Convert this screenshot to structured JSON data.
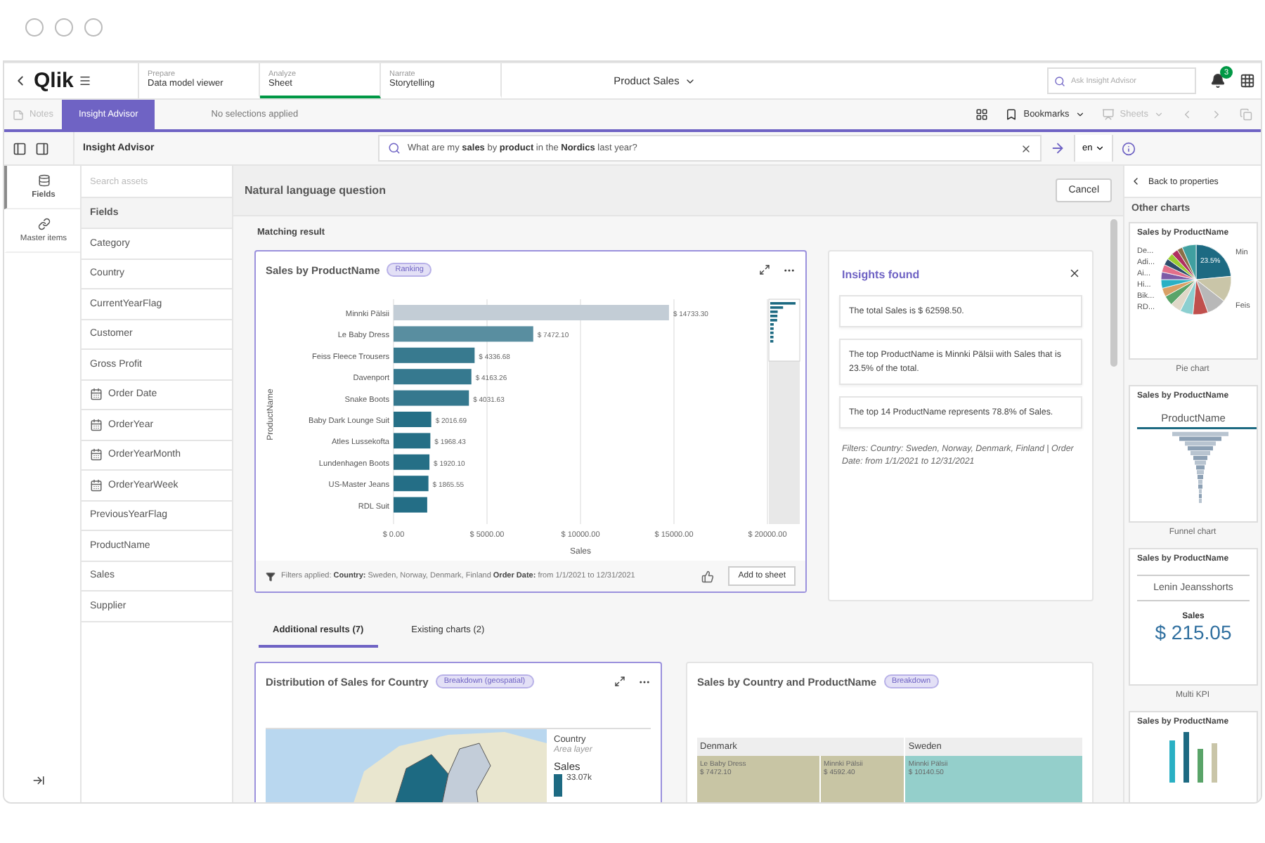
{
  "nav": {
    "logo": "Qlik",
    "tabs": [
      {
        "over": "Prepare",
        "label": "Data model viewer",
        "selected": false
      },
      {
        "over": "Analyze",
        "label": "Sheet",
        "selected": true
      },
      {
        "over": "Narrate",
        "label": "Storytelling",
        "selected": false
      }
    ],
    "app_title": "Product Sales",
    "search": {
      "placeholder": "Ask Insight Advisor"
    },
    "notification_count": "3"
  },
  "toolbar": {
    "notes": {
      "label": "Notes",
      "disabled": true
    },
    "mode_tab": {
      "label": "Insight Advisor",
      "selected": true
    },
    "selections": "No selections applied",
    "bookmarks": "Bookmarks",
    "sheets": {
      "label": "Sheets",
      "disabled": true
    }
  },
  "advisor_bar": {
    "title": "Insight Advisor",
    "query": "What are my **sales** by **product** in the **Nordics** last year?",
    "language": "en"
  },
  "rail": [
    {
      "label": "Fields",
      "selected": true
    },
    {
      "label": "Master items",
      "selected": false
    }
  ],
  "assets": {
    "placeholder": "Search assets",
    "heading": "Fields",
    "items": [
      {
        "label": "Category",
        "kind": "text"
      },
      {
        "label": "Country",
        "kind": "text"
      },
      {
        "label": "CurrentYearFlag",
        "kind": "text"
      },
      {
        "label": "Customer",
        "kind": "text"
      },
      {
        "label": "Gross Profit",
        "kind": "text"
      },
      {
        "label": "Order Date",
        "kind": "date"
      },
      {
        "label": "OrderYear",
        "kind": "date"
      },
      {
        "label": "OrderYearMonth",
        "kind": "date"
      },
      {
        "label": "OrderYearWeek",
        "kind": "date"
      },
      {
        "label": "PreviousYearFlag",
        "kind": "text"
      },
      {
        "label": "ProductName",
        "kind": "text"
      },
      {
        "label": "Sales",
        "kind": "text"
      },
      {
        "label": "Supplier",
        "kind": "text"
      }
    ]
  },
  "main": {
    "title": "Natural language question",
    "cancel": "Cancel",
    "section": "Matching result",
    "result": {
      "title": "Sales by ProductName",
      "tag": "Ranking",
      "chart_data": {
        "type": "bar",
        "orientation": "horizontal",
        "grid": true,
        "xlabel": "Sales",
        "ylabel": "ProductName",
        "categories": [
          "Minnki Pälsii",
          "Le Baby Dress",
          "Feiss Fleece Trousers",
          "Davenport",
          "Snake Boots",
          "Baby Dark Lounge Suit",
          "Atles Lussekofta",
          "Lundenhagen Boots",
          "US-Master Jeans",
          "RDL Suit"
        ],
        "values": [
          14733.3,
          7472.1,
          4336.68,
          4163.26,
          4031.63,
          2016.69,
          1968.43,
          1920.1,
          1865.55,
          1800
        ],
        "value_labels": [
          "$ 14733.30",
          "$ 7472.10",
          "$ 4336.68",
          "$ 4163.26",
          "$ 4031.63",
          "$ 2016.69",
          "$ 1968.43",
          "$ 1920.10",
          "$ 1865.55",
          null
        ],
        "xlim": [
          0,
          20000
        ],
        "xticks": [
          {
            "value": 0,
            "label": "$ 0.00"
          },
          {
            "value": 5000,
            "label": "$ 5000.00"
          },
          {
            "value": 10000,
            "label": "$ 10000.00"
          },
          {
            "value": 15000,
            "label": "$ 15000.00"
          },
          {
            "value": 20000,
            "label": "$ 20000.00"
          }
        ]
      },
      "filters_label": "Filters applied:",
      "filters": "**Country:** Sweden, Norway, Denmark, Finland **Order Date:** from 1/1/2021 to 12/31/2021",
      "add": "Add to sheet"
    },
    "insights": {
      "title": "Insights found",
      "items": [
        "The total Sales is $ 62598.50.",
        "The top ProductName is Minnki Pälsii with Sales that is 23.5% of the total.",
        "The top 14 ProductName represents 78.8% of Sales."
      ],
      "filters": "Filters: Country: Sweden, Norway, Denmark, Finland | Order Date: from 1/1/2021 to 12/31/2021"
    },
    "tabs": [
      {
        "label": "Additional results (7)",
        "selected": true
      },
      {
        "label": "Existing charts (2)",
        "selected": false
      }
    ],
    "map_card": {
      "title": "Distribution of Sales for Country",
      "tag": "Breakdown (geospatial)",
      "legend_title": "Country",
      "legend_sub": "Area layer",
      "legend_measure": "Sales",
      "legend_value": "33.07k"
    },
    "treemap_card": {
      "title": "Sales by Country and ProductName",
      "tag": "Breakdown",
      "groups": [
        {
          "label": "Denmark",
          "cells": [
            {
              "name": "Le Baby Dress",
              "value": "$ 7472.10"
            },
            {
              "name": "Minnki Pälsii",
              "value": "$ 4592.40"
            }
          ]
        },
        {
          "label": "Sweden",
          "cells": [
            {
              "name": "Minnki Pälsii",
              "value": "$ 10140.50"
            }
          ]
        }
      ]
    }
  },
  "other_charts": {
    "back": "Back to properties",
    "title": "Other charts",
    "cards": [
      {
        "kind": "pie",
        "title": "Sales by ProductName",
        "caption": "Pie chart",
        "labels": [
          "De...",
          "Adi...",
          "Ai...",
          "Hi...",
          "Bik...",
          "RD..."
        ],
        "right_labels": [
          "Min",
          "Feis"
        ],
        "share": "23.5%"
      },
      {
        "kind": "funnel",
        "title": "Sales by ProductName",
        "caption": "Funnel chart",
        "dimension": "ProductName"
      },
      {
        "kind": "kpi",
        "title": "Sales by ProductName",
        "caption": "Multi KPI",
        "item": "Lenin Jeansshorts",
        "measure": "Sales",
        "value": "$ 215.05"
      },
      {
        "kind": "partial",
        "title": "Sales by ProductName"
      }
    ]
  }
}
